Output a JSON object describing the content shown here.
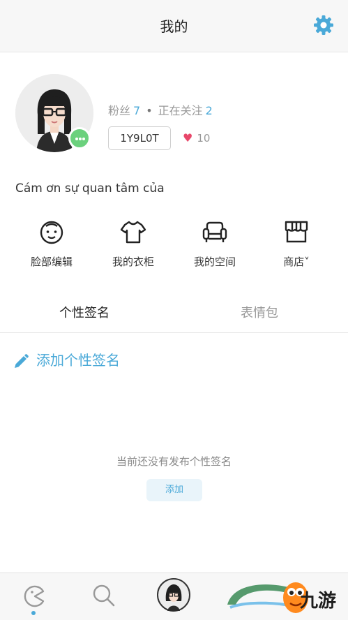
{
  "header": {
    "title": "我的"
  },
  "profile": {
    "followers_label": "粉丝",
    "followers_count": "7",
    "separator": "•",
    "following_label": "正在关注",
    "following_count": "2",
    "user_id": "1Y9L0T",
    "likes_count": "10",
    "bio": "Cám ơn sự quan tâm của"
  },
  "actions": [
    {
      "label": "脸部编辑",
      "icon": "face-icon"
    },
    {
      "label": "我的衣柜",
      "icon": "shirt-icon"
    },
    {
      "label": "我的空间",
      "icon": "sofa-icon"
    },
    {
      "label": "商店˅",
      "icon": "store-icon"
    }
  ],
  "tabs": [
    {
      "label": "个性签名",
      "active": true
    },
    {
      "label": "表情包",
      "active": false
    }
  ],
  "signature": {
    "add_label": "添加个性签名",
    "empty_text": "当前还没有发布个性签名",
    "add_button": "添加"
  },
  "tabbar": [
    "home-icon",
    "search-icon",
    "avatar-icon"
  ],
  "watermark": {
    "text": "九游"
  },
  "colors": {
    "accent": "#4aa9d8",
    "badge": "#6bd17d",
    "heart": "#e8476a"
  }
}
